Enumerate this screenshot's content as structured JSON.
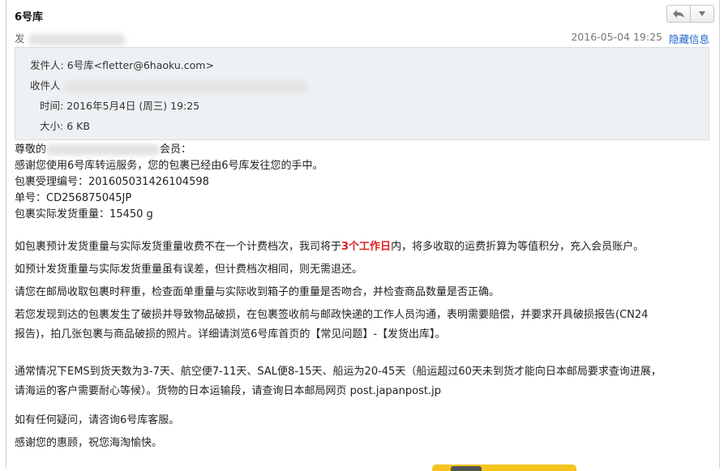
{
  "email": {
    "subject": "6号库",
    "from_short_label": "发",
    "date": "2016-05-04 19:25",
    "hide_info": "隐藏信息",
    "nav": {
      "reply_icon": "reply-icon",
      "menu_icon": "chevron-down-icon"
    },
    "details": {
      "from_label": "发件人:",
      "from_name": "6号库",
      "from_email": "<fletter@6haoku.com>",
      "to_label": "收件人",
      "time_label": "时间:",
      "time_value": "2016年5月4日 (周三) 19:25",
      "size_label": "大小:",
      "size_value": "6 KB"
    },
    "body": {
      "greeting_pre": "尊敬的",
      "greeting_post": "会员：",
      "line1": "感谢您使用6号库转运服务，您的包裹已经由6号库发往您的手中。",
      "line2": "包裹受理编号：201605031426104598",
      "line3": "单号：CD256875045JP",
      "line4": "包裹实际发货重量：15450 g",
      "para1_pre": "如包裹预计发货重量与实际发货重量收费不在一个计费档次，我司将于",
      "para1_hl": "3个工作日",
      "para1_post": "内，将多收取的运费折算为等值积分，充入会员账户。",
      "para2": "如预计发货重量与实际发货重量虽有误差，但计费档次相同，则无需退还。",
      "para3": "请您在邮局收取包裹时秤重，检查面单重量与实际收到箱子的重量是否吻合，并检查商品数量是否正确。",
      "para4a": "若您发现到达的包裹发生了破损并导致物品破损，在包裹签收前与邮政快递的工作人员沟通，表明需要赔偿，并要求开具破损报告(CN24",
      "para4b": "报告)，拍几张包裹与商品破损的照片。详细请浏览6号库首页的【常见问题】-【发货出库】。",
      "para5a": "通常情况下EMS到货天数为3-7天、航空便7-11天、SAL便8-15天、船运为20-45天（船运超过60天未到货才能向日本邮局要求查询进展，",
      "para5b": "请海运的客户需要耐心等候）。货物的日本运输段，请查询日本邮局网页 post.japanpost.jp",
      "para6": "如有任何疑问，请咨询6号库客服。",
      "para7": "感谢您的惠顾，祝您海淘愉快。"
    }
  }
}
